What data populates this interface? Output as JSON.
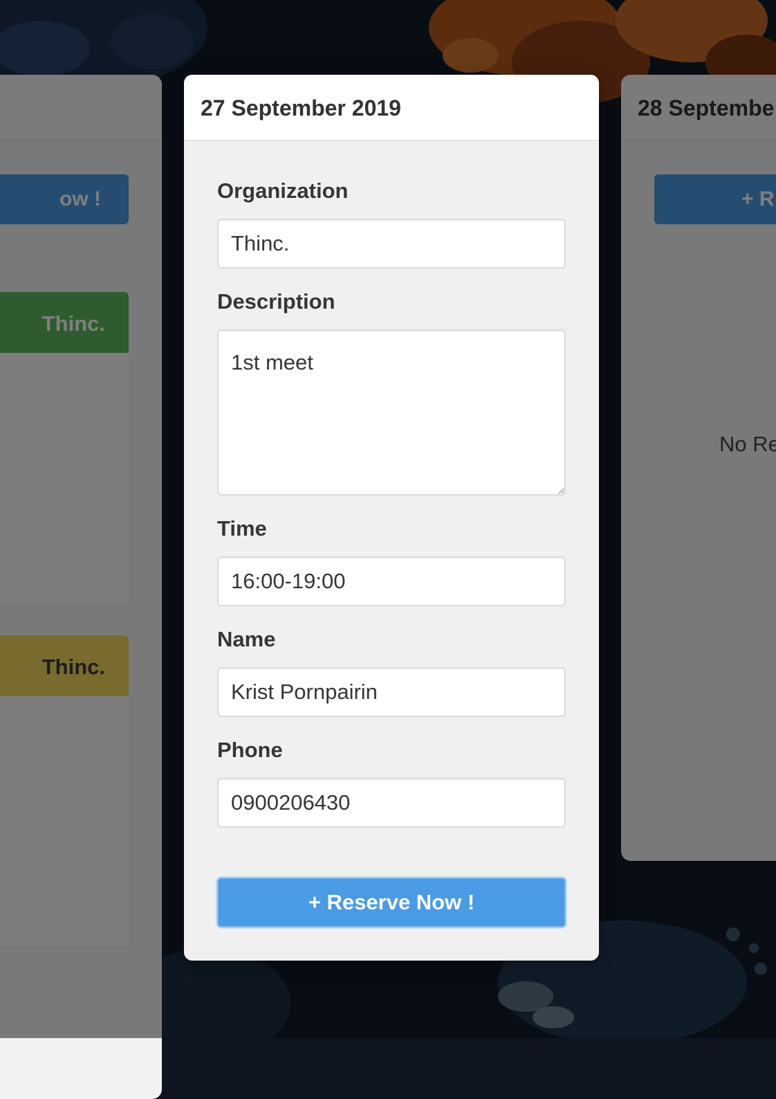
{
  "left_card": {
    "button_label": "ow !",
    "events": [
      {
        "org": "Thinc.",
        "color": "#5cb85c"
      },
      {
        "org": "Thinc.",
        "color": "#f0d65a"
      }
    ]
  },
  "right_card": {
    "date": "28 Septembe",
    "button_label": "+ R",
    "empty_text": "No Re"
  },
  "modal": {
    "date": "27 September 2019",
    "fields": {
      "organization": {
        "label": "Organization",
        "value": "Thinc."
      },
      "description": {
        "label": "Description",
        "value": "1st meet"
      },
      "time": {
        "label": "Time",
        "value": "16:00-19:00"
      },
      "name": {
        "label": "Name",
        "value": "Krist Pornpairin"
      },
      "phone": {
        "label": "Phone",
        "value": "0900206430"
      }
    },
    "submit_label": "+ Reserve Now !"
  },
  "colors": {
    "primary": "#4a9be5",
    "success": "#5cb85c",
    "warning": "#f0d65a"
  }
}
